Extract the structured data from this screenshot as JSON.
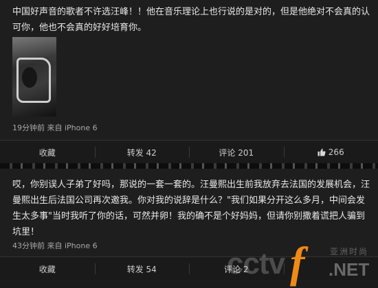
{
  "posts": [
    {
      "text": "中国好声音的歌者不许选汪峰！！他在音乐理论上也行说的是对的，但是他绝对不会真的认可你，他也不会真的好好培育你。",
      "meta": "19分钟前 来自 iPhone 6",
      "actions": {
        "collect": "收藏",
        "repost": "转发 42",
        "comment": "评论 201",
        "like": "266"
      }
    },
    {
      "text": "哎，你别误人子弟了好吗，那说的一套一套的。汪曼熙出生前我放弃去法国的发展机会，汪曼熙出生后法国公司再次邀我。你对我的说辞是什么？\"我们如果分开这么多月，中间会发生太多事\"当时我听了你的话，可然并卵！我的确不是个好妈妈，但请你别撒着谎把人骗到坑里！",
      "meta": "43分钟前 来自 iPhone 6",
      "actions": {
        "collect": "收藏",
        "repost": "转发 54",
        "comment": "评论 2"
      }
    }
  ],
  "watermark": {
    "brand_a": "cctv",
    "brand_b": "f",
    "brand_c": ".NET",
    "cn": "亚洲时尚"
  },
  "colors": {
    "background": "#1e1e1e",
    "accent": "#f08a16"
  }
}
